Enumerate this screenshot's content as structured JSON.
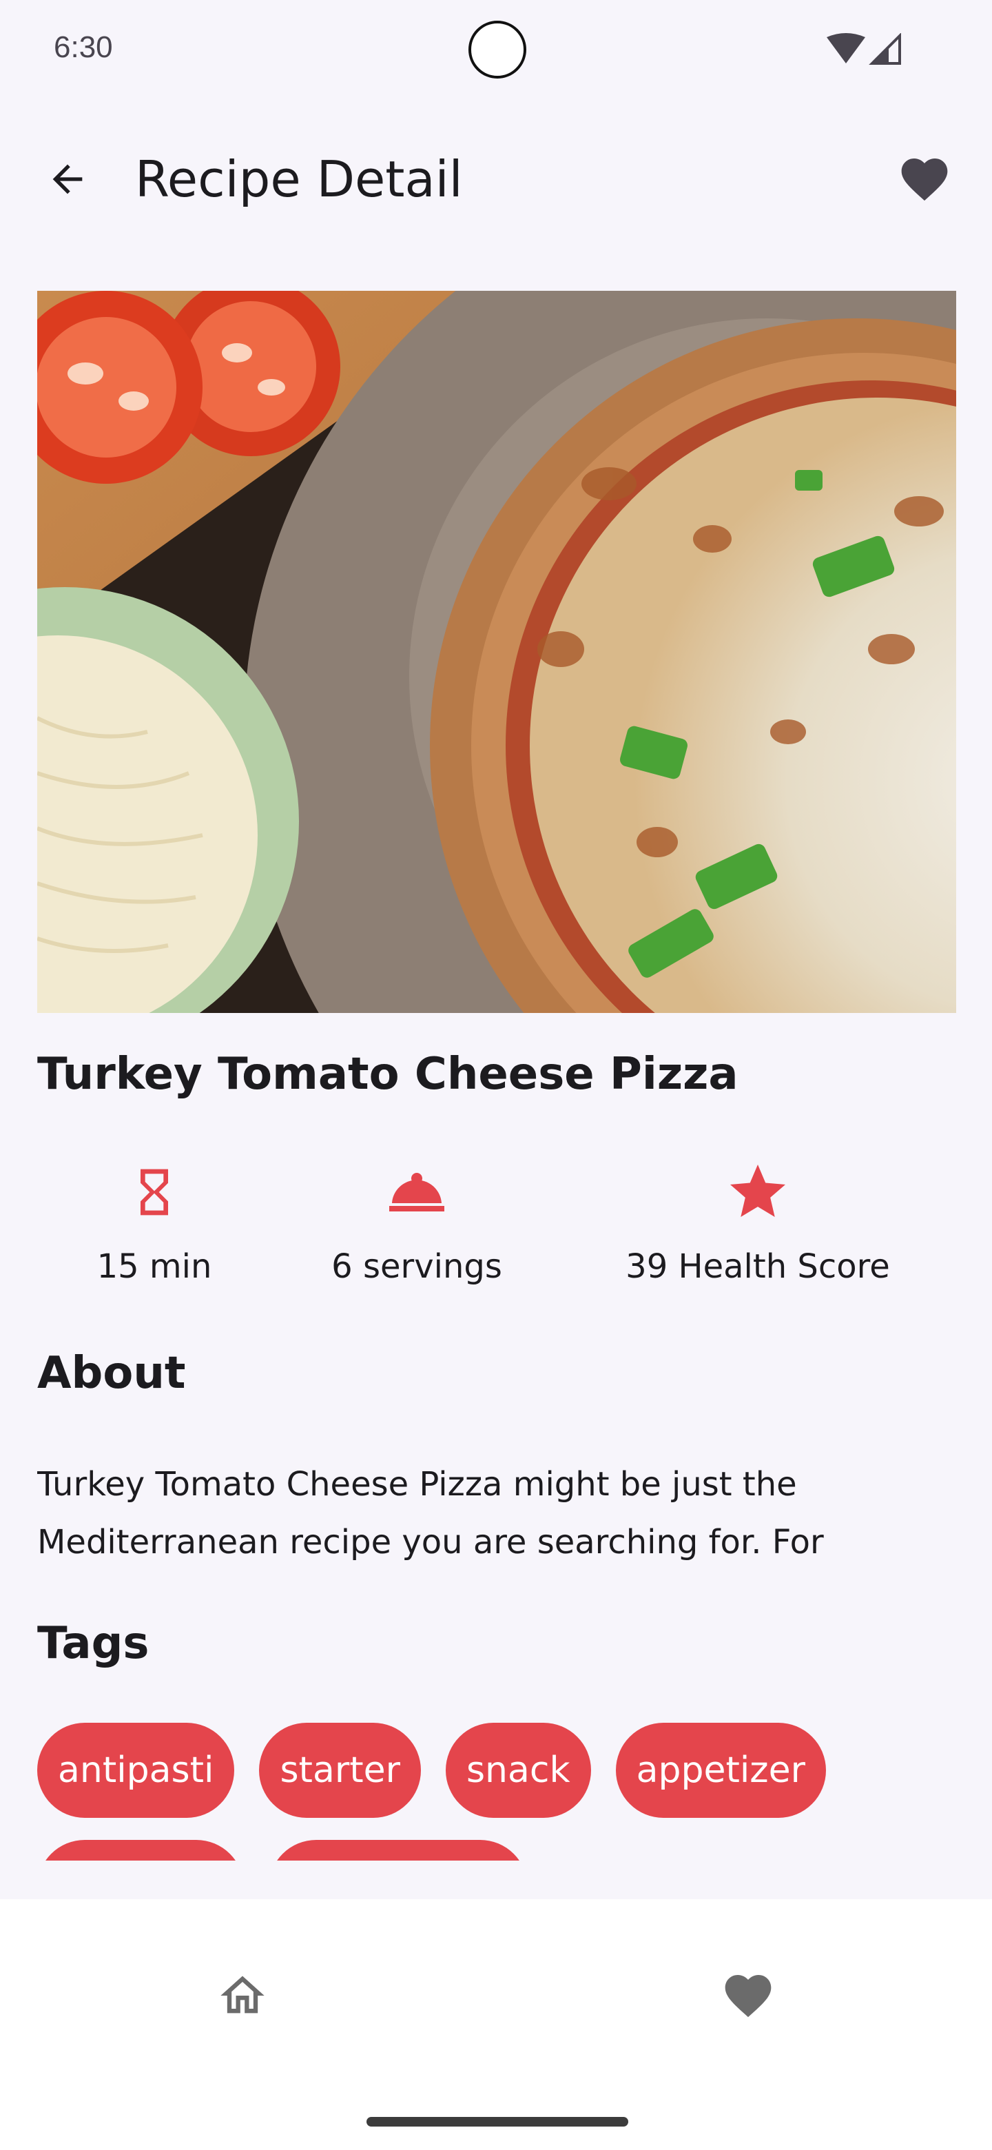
{
  "status_bar": {
    "time": "6:30"
  },
  "app_bar": {
    "title": "Recipe Detail",
    "back_icon": "arrow-back-icon",
    "favorite_icon": "heart-icon"
  },
  "recipe": {
    "title": "Turkey Tomato Cheese Pizza",
    "image_alt": "Turkey Tomato Cheese Pizza photo",
    "stats": {
      "time": "15 min",
      "servings": "6 servings",
      "health": "39 Health Score"
    }
  },
  "about": {
    "heading": "About",
    "text": "Turkey Tomato Cheese Pizza might be just the Mediterranean recipe you are searching for. For"
  },
  "tags": {
    "heading": "Tags",
    "items": [
      "antipasti",
      "starter",
      "snack",
      "appetizer"
    ]
  },
  "bottom_nav": {
    "home_icon": "home-icon",
    "favorites_icon": "heart-icon"
  },
  "colors": {
    "accent": "#e4454c",
    "background": "#f7f5fb",
    "icon_dark": "#49454f"
  }
}
